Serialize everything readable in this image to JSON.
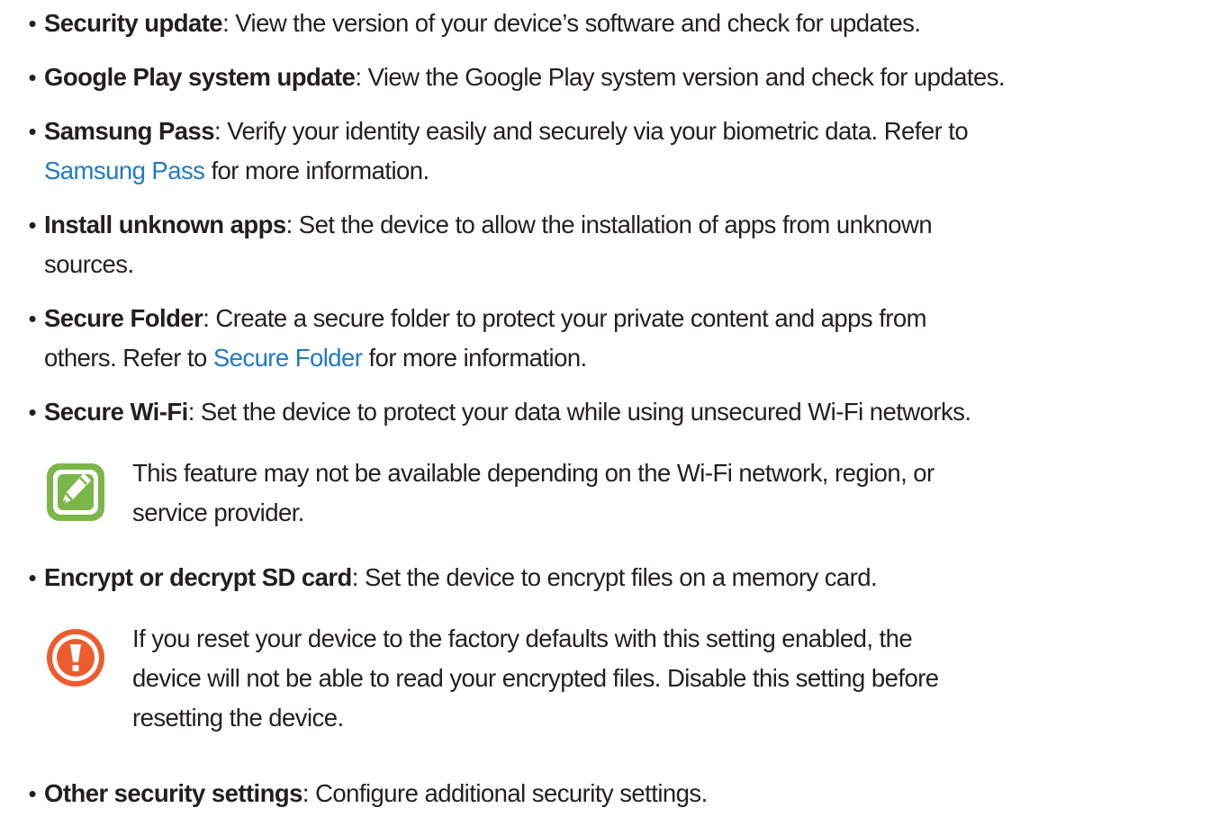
{
  "items": [
    {
      "bold": "Security update",
      "lines": [
        ": View the version of your device’s software and check for updates."
      ]
    },
    {
      "bold": "Google Play system update",
      "lines": [
        ": View the Google Play system version and check for updates."
      ]
    },
    {
      "bold": "Samsung Pass",
      "line1": ": Verify your identity easily and securely via your biometric data. Refer to",
      "link": "Samsung Pass",
      "line2_rest": " for more information."
    },
    {
      "bold": "Install unknown apps",
      "line1": ": Set the device to allow the installation of apps from unknown",
      "line2": "sources."
    },
    {
      "bold": "Secure Folder",
      "line1": ": Create a secure folder to protect your private content and apps from",
      "line2_pre": "others. Refer to ",
      "link": "Secure Folder",
      "line2_rest": " for more information."
    },
    {
      "bold": "Secure Wi-Fi",
      "line1": ": Set the device to protect your data while using unsecured Wi-Fi networks.",
      "note": {
        "icon": "note-pencil-icon",
        "line1": "This feature may not be available depending on the Wi-Fi network, region, or",
        "line2": "service provider."
      }
    },
    {
      "bold": "Encrypt or decrypt SD card",
      "line1": ": Set the device to encrypt files on a memory card.",
      "caution": {
        "icon": "caution-exclamation-icon",
        "line1": "If you reset your device to the factory defaults with this setting enabled, the",
        "line2": "device will not be able to read your encrypted files. Disable this setting before",
        "line3": "resetting the device."
      }
    },
    {
      "bold": "Other security settings",
      "line1": ": Configure additional security settings."
    }
  ],
  "bullet_char": "•",
  "colors": {
    "text": "#231f20",
    "link": "#1f7ac4",
    "note_green": "#7ab648",
    "caution_orange": "#ee5b2c"
  }
}
